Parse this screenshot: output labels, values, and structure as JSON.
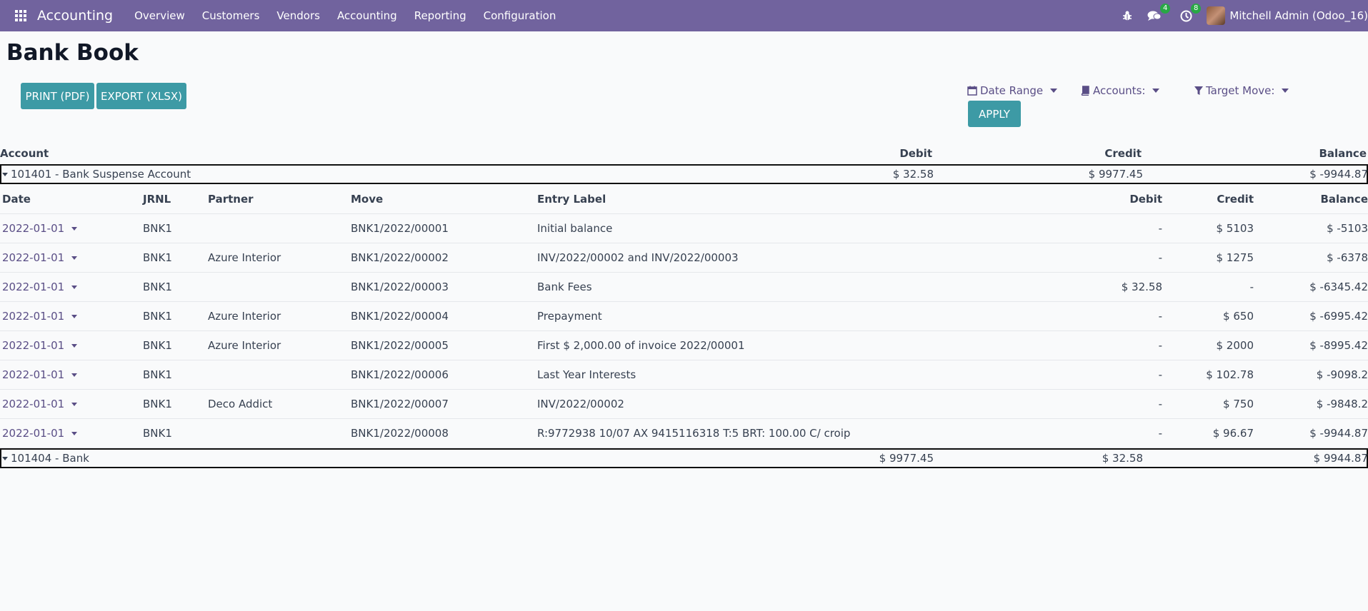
{
  "navbar": {
    "app_name": "Accounting",
    "menu": [
      "Overview",
      "Customers",
      "Vendors",
      "Accounting",
      "Reporting",
      "Configuration"
    ],
    "icons": {
      "debug": "bug-icon",
      "messages": "chat-icon",
      "activities": "clock-icon"
    },
    "messages_count": "4",
    "activities_count": "8",
    "user_name": "Mitchell Admin (Odoo_16)",
    "color": "#71639e"
  },
  "page": {
    "title": "Bank Book",
    "buttons": {
      "print": "PRINT (PDF)",
      "export": "EXPORT (XLSX)",
      "apply": "APPLY"
    },
    "filters": {
      "date_range": "Date Range",
      "accounts": "Accounts:",
      "target_move": "Target Move:"
    },
    "accent_color": "#3d9aa5"
  },
  "summary": {
    "headers": {
      "account": "Account",
      "debit": "Debit",
      "credit": "Credit",
      "balance": "Balance"
    },
    "accounts": [
      {
        "name": "101401 - Bank Suspense Account",
        "debit": "$ 32.58",
        "credit": "$ 9977.45",
        "balance": "$ -9944.87",
        "expanded": true
      },
      {
        "name": "101404 - Bank",
        "debit": "$ 9977.45",
        "credit": "$ 32.58",
        "balance": "$ 9944.87",
        "expanded": false
      }
    ]
  },
  "detail": {
    "headers": {
      "date": "Date",
      "jrnl": "JRNL",
      "partner": "Partner",
      "move": "Move",
      "entry_label": "Entry Label",
      "debit": "Debit",
      "credit": "Credit",
      "balance": "Balance"
    },
    "rows": [
      {
        "date": "2022-01-01",
        "jrnl": "BNK1",
        "partner": "",
        "move": "BNK1/2022/00001",
        "label": "Initial balance",
        "debit": "-",
        "credit": "$ 5103",
        "balance": "$ -5103"
      },
      {
        "date": "2022-01-01",
        "jrnl": "BNK1",
        "partner": "Azure Interior",
        "move": "BNK1/2022/00002",
        "label": "INV/2022/00002 and INV/2022/00003",
        "debit": "-",
        "credit": "$ 1275",
        "balance": "$ -6378"
      },
      {
        "date": "2022-01-01",
        "jrnl": "BNK1",
        "partner": "",
        "move": "BNK1/2022/00003",
        "label": "Bank Fees",
        "debit": "$ 32.58",
        "credit": "-",
        "balance": "$ -6345.42"
      },
      {
        "date": "2022-01-01",
        "jrnl": "BNK1",
        "partner": "Azure Interior",
        "move": "BNK1/2022/00004",
        "label": "Prepayment",
        "debit": "-",
        "credit": "$ 650",
        "balance": "$ -6995.42"
      },
      {
        "date": "2022-01-01",
        "jrnl": "BNK1",
        "partner": "Azure Interior",
        "move": "BNK1/2022/00005",
        "label": "First $ 2,000.00 of invoice 2022/00001",
        "debit": "-",
        "credit": "$ 2000",
        "balance": "$ -8995.42"
      },
      {
        "date": "2022-01-01",
        "jrnl": "BNK1",
        "partner": "",
        "move": "BNK1/2022/00006",
        "label": "Last Year Interests",
        "debit": "-",
        "credit": "$ 102.78",
        "balance": "$ -9098.2"
      },
      {
        "date": "2022-01-01",
        "jrnl": "BNK1",
        "partner": "Deco Addict",
        "move": "BNK1/2022/00007",
        "label": "INV/2022/00002",
        "debit": "-",
        "credit": "$ 750",
        "balance": "$ -9848.2"
      },
      {
        "date": "2022-01-01",
        "jrnl": "BNK1",
        "partner": "",
        "move": "BNK1/2022/00008",
        "label": "R:9772938 10/07 AX 9415116318 T:5 BRT: 100.00 C/ croip",
        "debit": "-",
        "credit": "$ 96.67",
        "balance": "$ -9944.87"
      }
    ]
  }
}
